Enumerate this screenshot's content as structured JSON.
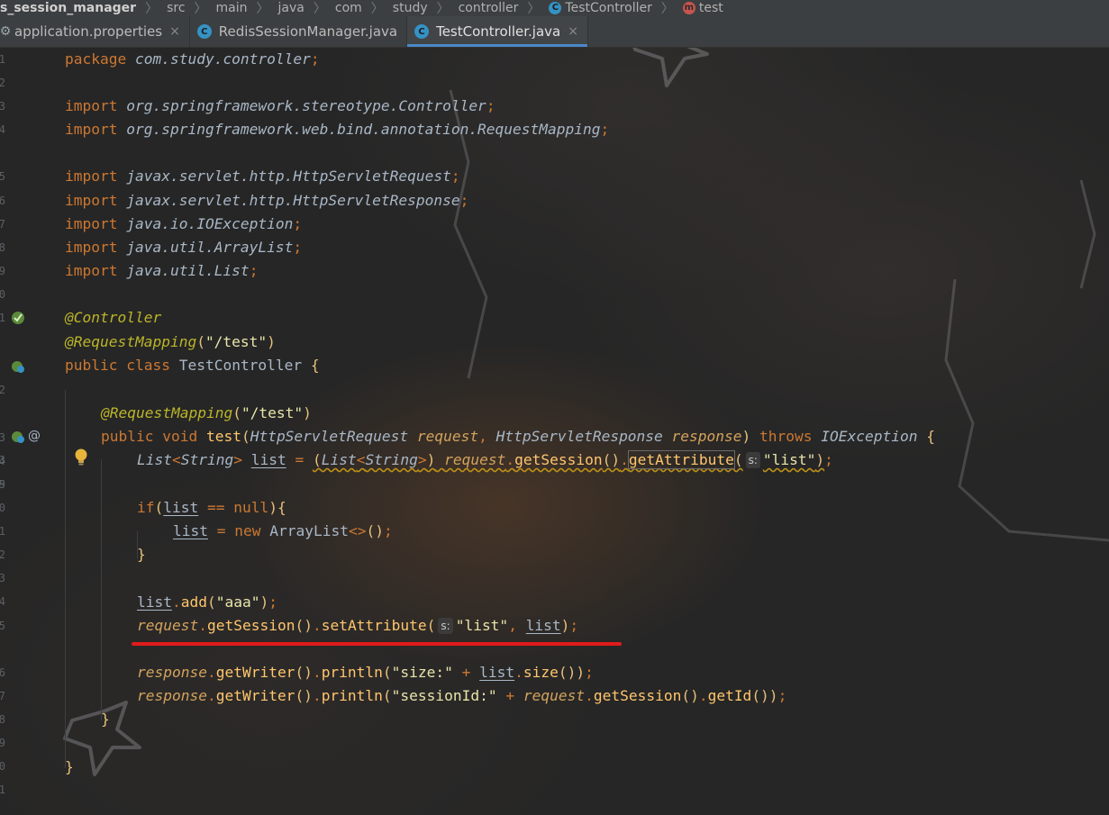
{
  "breadcrumb": {
    "items": [
      {
        "label": "s_session_manager"
      },
      {
        "label": "src"
      },
      {
        "label": "main"
      },
      {
        "label": "java"
      },
      {
        "label": "com"
      },
      {
        "label": "study"
      },
      {
        "label": "controller"
      },
      {
        "label": "TestController",
        "icon": "class-icon"
      },
      {
        "label": "test",
        "icon": "method-icon"
      }
    ],
    "separator": "〉"
  },
  "tabs": [
    {
      "label": "application.properties",
      "icon": "gear-icon",
      "close": "×"
    },
    {
      "label": "RedisSessionManager.java",
      "icon": "class-icon",
      "icon_text": "C",
      "close": ""
    },
    {
      "label": "TestController.java",
      "icon": "class-icon",
      "icon_text": "C",
      "close": "×",
      "active": true
    }
  ],
  "gutter": {
    "line_numbers": [
      "1",
      "2",
      "3",
      "4",
      "5",
      "6",
      "7",
      "8",
      "9",
      "0",
      "1",
      "2",
      "3",
      "4",
      "5",
      "6",
      "7",
      "8",
      "3",
      "9",
      "0",
      "1",
      "2",
      "3",
      "4",
      "5",
      "6",
      "7",
      "8",
      "9",
      "0",
      "1",
      "2"
    ],
    "icons": {
      "spring_bean": "spring-bean-icon",
      "spring_request": "spring-mapping-icon",
      "at": "@"
    }
  },
  "code": {
    "l1_kw": "package",
    "l1_pkg": "com.study.controller",
    "semi": ";",
    "import": "import",
    "i1": "org.springframework.stereotype.Controller",
    "i2": "org.springframework.web.bind.annotation.RequestMapping",
    "i3": "javax.servlet.http.HttpServletRequest",
    "i4": "javax.servlet.http.HttpServletResponse",
    "i5": "java.io.IOException",
    "i6": "java.util.ArrayList",
    "i7": "java.util.List",
    "ann_controller": "@Controller",
    "ann_rm": "@RequestMapping",
    "path_test": "\"/test\"",
    "public": "public",
    "class": "class",
    "void": "void",
    "throws": "throws",
    "class_name": "TestController",
    "method_name": "test",
    "t_req": "HttpServletRequest",
    "p_req": "request",
    "t_resp": "HttpServletResponse",
    "p_resp": "response",
    "t_ioe": "IOException",
    "t_list": "List",
    "t_string": "String",
    "v_list": "list",
    "m_getSession": "getSession",
    "m_getAttribute": "getAttribute",
    "m_setAttribute": "setAttribute",
    "hint_s": "s:",
    "str_list": "\"list\"",
    "kw_if": "if",
    "kw_null": "null",
    "kw_new": "new",
    "t_arraylist": "ArrayList",
    "m_add": "add",
    "str_aaa": "\"aaa\"",
    "m_getWriter": "getWriter",
    "m_println": "println",
    "str_size": "\"size:\"",
    "m_size": "size",
    "str_sessionId": "\"sessionId:\"",
    "m_getId": "getId"
  }
}
